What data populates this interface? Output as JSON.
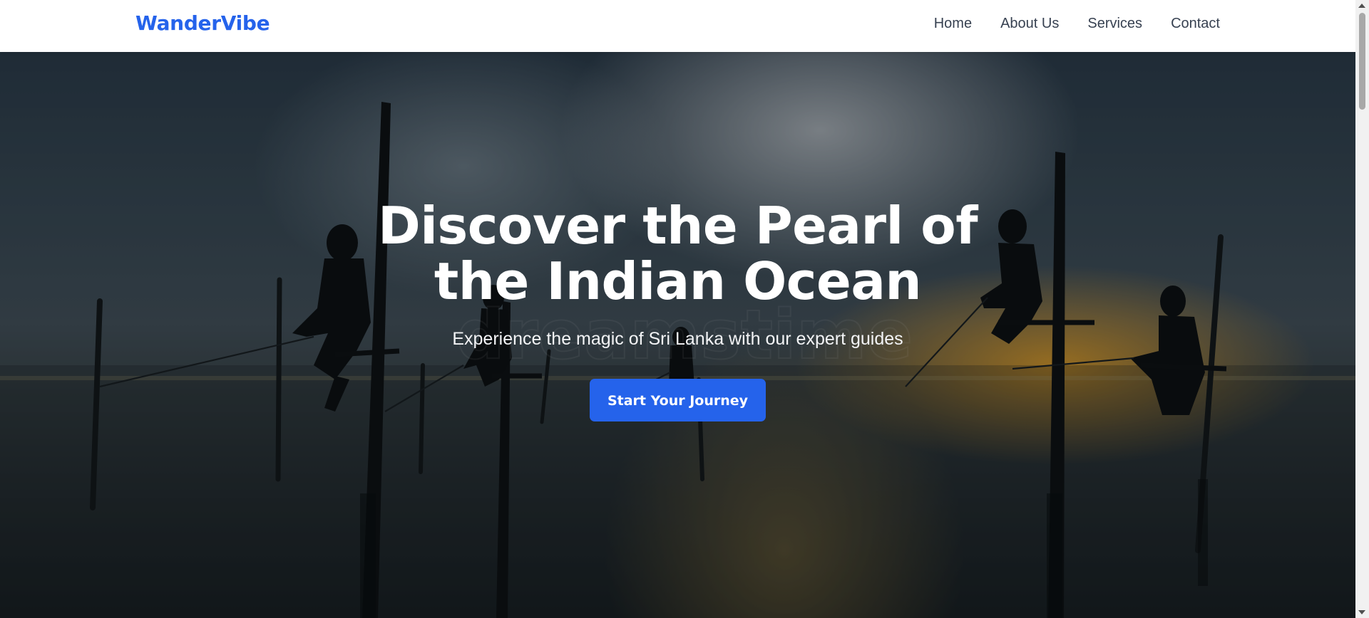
{
  "header": {
    "brand": "WanderVibe",
    "nav": [
      {
        "label": "Home"
      },
      {
        "label": "About Us"
      },
      {
        "label": "Services"
      },
      {
        "label": "Contact"
      }
    ]
  },
  "hero": {
    "title": "Discover the Pearl of the Indian Ocean",
    "subtitle": "Experience the magic of Sri Lanka with our expert guides",
    "cta_label": "Start Your Journey",
    "background_image": "stilt-fishermen-silhouettes-at-sunset"
  },
  "colors": {
    "brand": "#2563eb",
    "nav_text": "#374151",
    "cta_bg": "#2563eb",
    "hero_text": "#ffffff"
  },
  "icons": {
    "scroll_up": "chevron-up-icon",
    "scroll_down": "chevron-down-icon"
  }
}
